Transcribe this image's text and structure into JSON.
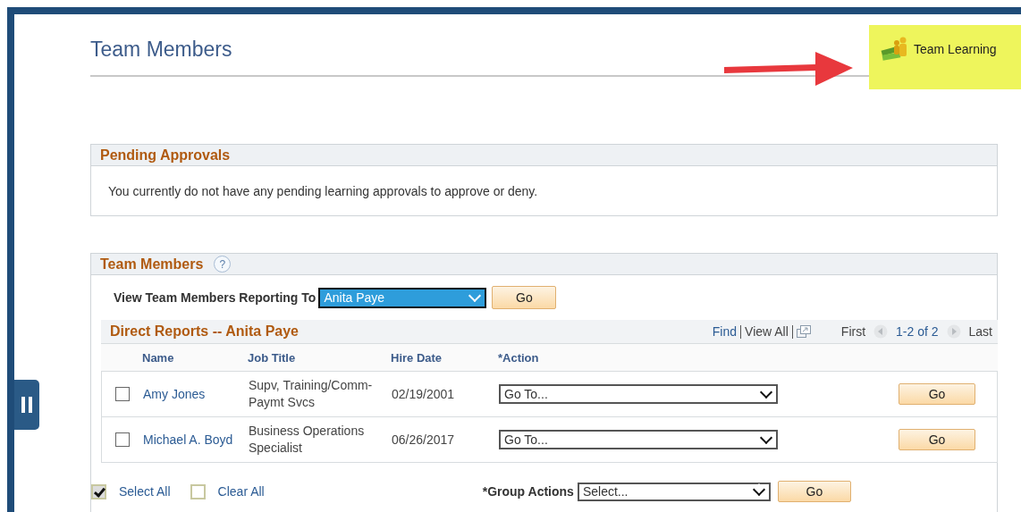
{
  "page": {
    "title": "Team Members",
    "team_learning": "Team Learning"
  },
  "pending": {
    "title": "Pending Approvals",
    "message": "You currently do not have any pending learning approvals to approve or deny."
  },
  "team_members": {
    "title": "Team Members",
    "help": "?",
    "reporting_label": "View Team Members Reporting To",
    "reporting_value": "Anita Paye",
    "go": "Go"
  },
  "direct_reports": {
    "title": "Direct Reports -- Anita Paye",
    "find": "Find",
    "view_all": "View All",
    "first": "First",
    "range": "1-2 of 2",
    "last": "Last",
    "columns": [
      "Name",
      "Job Title",
      "Hire Date",
      "*Action"
    ],
    "rows": [
      {
        "name": "Amy Jones",
        "job_title": "Supv, Training/Comm-Paymt Svcs",
        "hire_date": "02/19/2001",
        "action": "Go To...",
        "go": "Go",
        "checked": false
      },
      {
        "name": "Michael A. Boyd",
        "job_title": "Business Operations Specialist",
        "hire_date": "06/26/2017",
        "action": "Go To...",
        "go": "Go",
        "checked": false
      }
    ],
    "select_all": {
      "label": "Select All",
      "checked": true
    },
    "clear_all": {
      "label": "Clear All",
      "checked": false
    },
    "group_actions": {
      "label": "*Group Actions",
      "value": "Select...",
      "go": "Go"
    }
  }
}
